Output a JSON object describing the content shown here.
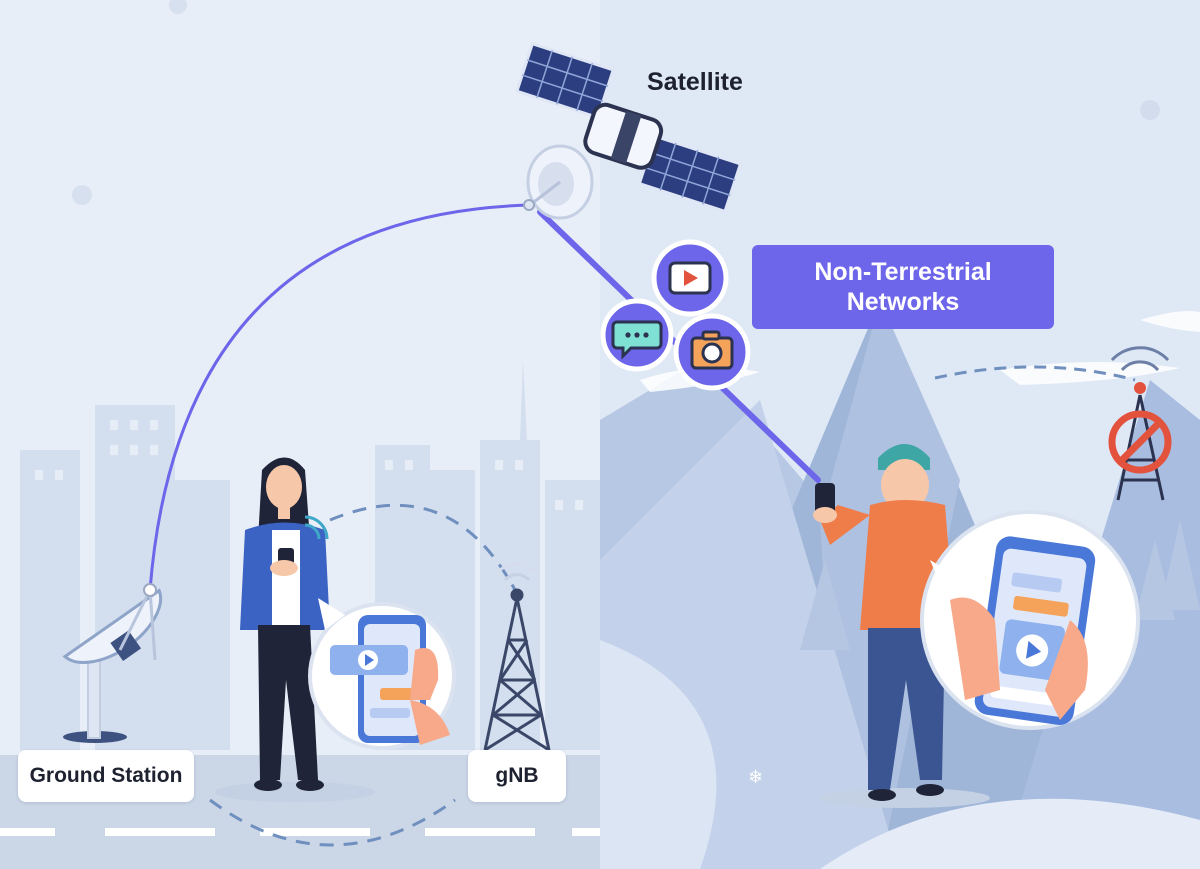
{
  "labels": {
    "satellite": "Satellite",
    "ntn_line1": "Non-Terrestrial",
    "ntn_line2": "Networks",
    "ground_station": "Ground Station",
    "gnb": "gNB"
  },
  "colors": {
    "link_purple": "#6d66ea",
    "sky_left": "#e8eef8",
    "sky_right": "#dfe8f5",
    "mountain": "#9fb6d9",
    "building": "#cfdbed",
    "road": "#cbd6e6",
    "orange": "#f0894a"
  },
  "icons": {
    "satellite": "satellite-icon",
    "dish": "satellite-dish-icon",
    "tower": "cell-tower-icon",
    "tower_disabled": "no-signal-tower-icon",
    "video": "play-video-icon",
    "chat": "chat-bubble-icon",
    "camera": "camera-icon"
  }
}
